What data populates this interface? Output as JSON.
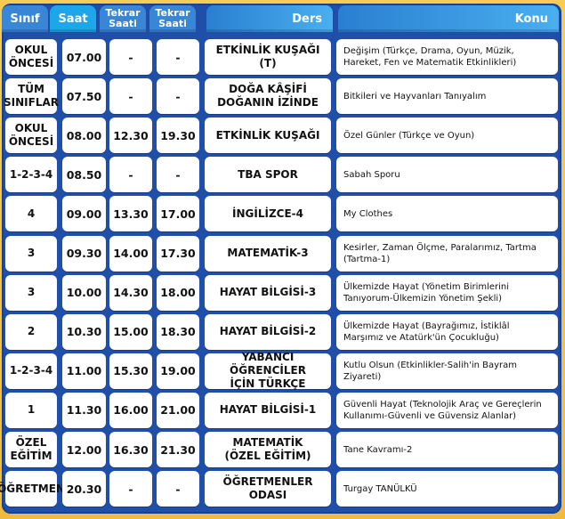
{
  "header": {
    "sinif": "Sınıf",
    "saat": "Saat",
    "tekrar1": "Tekrar\nSaati",
    "tekrar2": "Tekrar\nSaati",
    "ders": "Ders",
    "konu": "Konu"
  },
  "rows": [
    {
      "sinif": "OKUL\nÖNCESİ",
      "saat": "07.00",
      "tekrar1": "-",
      "tekrar2": "-",
      "ders": "ETKİNLİK KUŞAĞI (T)",
      "konu": "Değişim (Türkçe, Drama, Oyun, Müzik, Hareket, Fen ve Matematik Etkinlikleri)"
    },
    {
      "sinif": "TÜM\nSINIFLAR",
      "saat": "07.50",
      "tekrar1": "-",
      "tekrar2": "-",
      "ders": "DOĞA KÂŞİFİ\nDOĞANIN İZİNDE",
      "konu": "Bitkileri ve Hayvanları Tanıyalım"
    },
    {
      "sinif": "OKUL\nÖNCESİ",
      "saat": "08.00",
      "tekrar1": "12.30",
      "tekrar2": "19.30",
      "ders": "ETKİNLİK KUŞAĞI",
      "konu": "Özel Günler (Türkçe ve Oyun)"
    },
    {
      "sinif": "1-2-3-4",
      "saat": "08.50",
      "tekrar1": "-",
      "tekrar2": "-",
      "ders": "TBA SPOR",
      "konu": "Sabah Sporu"
    },
    {
      "sinif": "4",
      "saat": "09.00",
      "tekrar1": "13.30",
      "tekrar2": "17.00",
      "ders": "İNGİLİZCE-4",
      "konu": "My Clothes"
    },
    {
      "sinif": "3",
      "saat": "09.30",
      "tekrar1": "14.00",
      "tekrar2": "17.30",
      "ders": "MATEMATİK-3",
      "konu": "Kesirler, Zaman Ölçme, Paralarımız, Tartma (Tartma-1)"
    },
    {
      "sinif": "3",
      "saat": "10.00",
      "tekrar1": "14.30",
      "tekrar2": "18.00",
      "ders": "HAYAT BİLGİSİ-3",
      "konu": "Ülkemizde Hayat (Yönetim Birimlerini Tanıyorum-Ülkemizin Yönetim Şekli)"
    },
    {
      "sinif": "2",
      "saat": "10.30",
      "tekrar1": "15.00",
      "tekrar2": "18.30",
      "ders": "HAYAT BİLGİSİ-2",
      "konu": "Ülkemizde Hayat (Bayrağımız, İstiklâl Marşımız ve Atatürk'ün Çocukluğu)"
    },
    {
      "sinif": "1-2-3-4",
      "saat": "11.00",
      "tekrar1": "15.30",
      "tekrar2": "19.00",
      "ders": "YABANCI ÖĞRENCİLER\nİÇİN TÜRKÇE",
      "konu": "Kutlu Olsun (Etkinlikler-Salih'in Bayram Ziyareti)"
    },
    {
      "sinif": "1",
      "saat": "11.30",
      "tekrar1": "16.00",
      "tekrar2": "21.00",
      "ders": "HAYAT BİLGİSİ-1",
      "konu": "Güvenli Hayat (Teknolojik Araç ve Gereçlerin Kullanımı-Güvenli ve Güvensiz Alanlar)"
    },
    {
      "sinif": "ÖZEL\nEĞİTİM",
      "saat": "12.00",
      "tekrar1": "16.30",
      "tekrar2": "21.30",
      "ders": "MATEMATİK\n(ÖZEL EĞİTİM)",
      "konu": "Tane Kavramı-2"
    },
    {
      "sinif": "ÖĞRETMEN",
      "saat": "20.30",
      "tekrar1": "-",
      "tekrar2": "-",
      "ders": "ÖĞRETMENLER\nODASI",
      "konu": "Turgay TANÜLKÜ"
    }
  ]
}
